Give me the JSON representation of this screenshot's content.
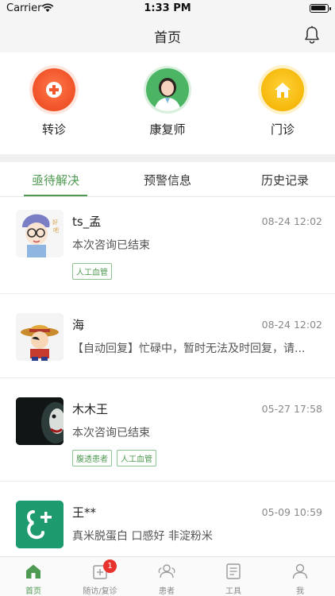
{
  "status_bar": {
    "carrier": "Carrier",
    "time": "1:33 PM"
  },
  "nav": {
    "title": "首页",
    "bell_icon": "bell-icon"
  },
  "quick_actions": [
    {
      "label": "转诊",
      "icon": "plus-circle-icon",
      "color": "#f2562b"
    },
    {
      "label": "康复师",
      "icon": "doctor-avatar-icon",
      "color": "#4cb564"
    },
    {
      "label": "门诊",
      "icon": "home-icon",
      "color": "#f6b80b"
    }
  ],
  "tabs": [
    {
      "label": "亟待解决",
      "active": true
    },
    {
      "label": "预警信息",
      "active": false
    },
    {
      "label": "历史记录",
      "active": false
    }
  ],
  "accent_color": "#4f9a52",
  "messages": [
    {
      "name": "ts_孟",
      "time": "08-24 12:02",
      "text": "本次咨询已结束",
      "tags": [
        "人工血管"
      ],
      "avatar": "cartoon-glasses-avatar"
    },
    {
      "name": "海",
      "time": "08-24 12:02",
      "text": "【自动回复】忙碌中，暂时无法及时回复，请...",
      "tags": [],
      "avatar": "cartoon-hat-avatar"
    },
    {
      "name": "木木王",
      "time": "05-27 17:58",
      "text": "本次咨询已结束",
      "tags": [
        "腹透患者",
        "人工血管"
      ],
      "avatar": "dark-joker-avatar"
    },
    {
      "name": "王**",
      "time": "05-09 10:59",
      "text": "真米脱蛋白 口感好 非淀粉米",
      "tags": [],
      "avatar": "green-logo-avatar"
    }
  ],
  "tab_bar": [
    {
      "label": "首页",
      "icon": "home-icon",
      "active": true
    },
    {
      "label": "随访/复诊",
      "icon": "followup-icon",
      "active": false,
      "badge": "1"
    },
    {
      "label": "患者",
      "icon": "patients-icon",
      "active": false
    },
    {
      "label": "工具",
      "icon": "tools-icon",
      "active": false
    },
    {
      "label": "我",
      "icon": "profile-icon",
      "active": false
    }
  ]
}
